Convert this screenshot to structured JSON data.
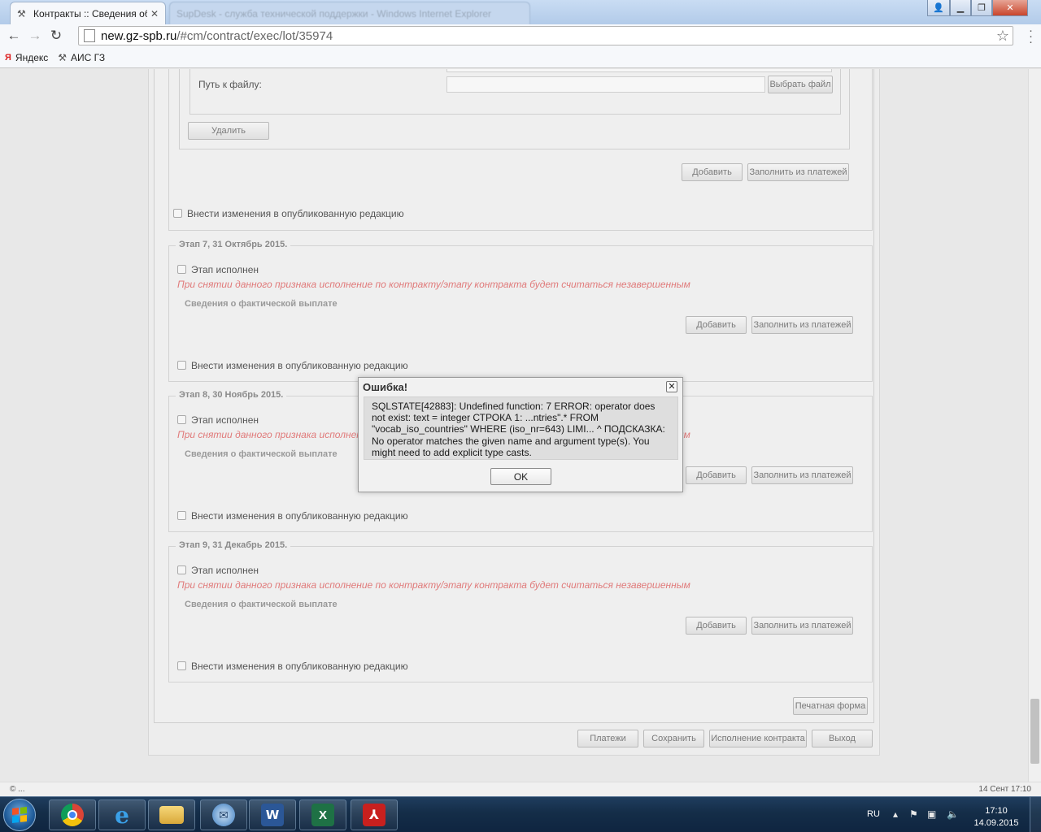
{
  "browser": {
    "active_tab_title": "Контракты :: Сведения об",
    "inactive_tab_title": "SupDesk - служба технической поддержки - Windows Internet Explorer",
    "url_host": "new.gz-spb.ru",
    "url_path": "/#cm/contract/exec/lot/35974",
    "bookmarks": [
      {
        "label": "Яндекс",
        "icon": "yandex-icon"
      },
      {
        "label": "АИС ГЗ",
        "icon": "tools-icon"
      }
    ]
  },
  "file_section": {
    "path_label": "Путь к файлу:",
    "choose_button": "Выбрать файл",
    "delete_button": "Удалить"
  },
  "upper_stage": {
    "add_button": "Добавить",
    "fill_button": "Заполнить из платежей",
    "publish_label": "Внести изменения в опубликованную редакцию"
  },
  "stages": [
    {
      "title": "Этап 7, 31 Октябрь 2015.",
      "done_label": "Этап исполнен",
      "warning": "При снятии данного признака исполнение по контракту/этапу контракта будет считаться незавершенным",
      "payments_heading": "Сведения о фактической выплате",
      "add_button": "Добавить",
      "fill_button": "Заполнить из платежей",
      "publish_label": "Внести изменения в опубликованную редакцию"
    },
    {
      "title": "Этап 8, 30 Ноябрь 2015.",
      "done_label": "Этап исполнен",
      "warning": "При снятии данного признака исполнение по контракту/этапу контракта будет считаться незавершенным",
      "payments_heading": "Сведения о фактической выплате",
      "add_button": "Добавить",
      "fill_button": "Заполнить из платежей",
      "publish_label": "Внести изменения в опубликованную редакцию"
    },
    {
      "title": "Этап 9, 31 Декабрь 2015.",
      "done_label": "Этап исполнен",
      "warning": "При снятии данного признака исполнение по контракту/этапу контракта будет считаться незавершенным",
      "payments_heading": "Сведения о фактической выплате",
      "add_button": "Добавить",
      "fill_button": "Заполнить из платежей",
      "publish_label": "Внести изменения в опубликованную редакцию"
    }
  ],
  "footer": {
    "print_button": "Печатная форма",
    "payments_button": "Платежи",
    "save_button": "Сохранить",
    "execution_button": "Исполнение контракта",
    "exit_button": "Выход"
  },
  "dialog": {
    "title": "Ошибка!",
    "message": "SQLSTATE[42883]: Undefined function: 7 ERROR: operator does not exist: text = integer СТРОКА 1: ...ntries\".* FROM \"vocab_iso_countries\" WHERE (iso_nr=643) LIMI... ^ ПОДСКАЗКА: No operator matches the given name and argument type(s). You might need to add explicit type casts.",
    "ok_button": "OK"
  },
  "status": {
    "left": "© ...",
    "right": "14 Сент 17:10"
  },
  "taskbar": {
    "apps": [
      "chrome-icon",
      "internet-explorer-icon",
      "file-explorer-icon",
      "mail-icon",
      "word-icon",
      "excel-icon",
      "acrobat-icon"
    ],
    "language": "RU",
    "time": "17:10",
    "date": "14.09.2015"
  }
}
